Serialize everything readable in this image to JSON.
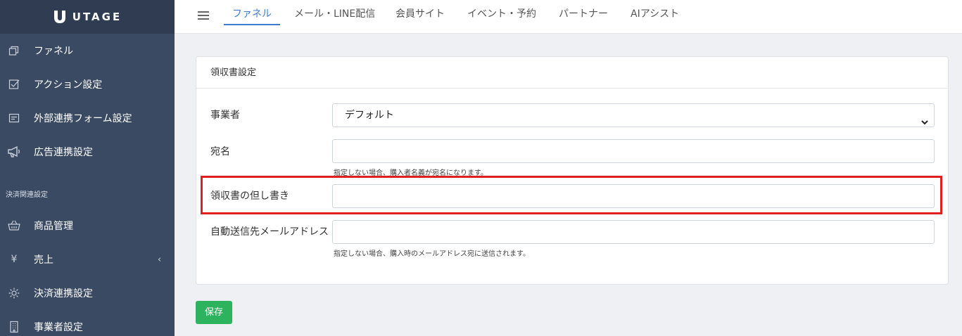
{
  "app": {
    "brand": "UTAGE"
  },
  "sidebar": {
    "items": [
      {
        "label": "ファネル",
        "icon": "funnel-pages-icon"
      },
      {
        "label": "アクション設定",
        "icon": "checkbox-icon"
      },
      {
        "label": "外部連携フォーム設定",
        "icon": "form-icon"
      },
      {
        "label": "広告連携設定",
        "icon": "megaphone-icon"
      }
    ],
    "section_label": "決済関連設定",
    "payment_items": [
      {
        "label": "商品管理",
        "icon": "basket-icon"
      },
      {
        "label": "売上",
        "icon": "yen-icon",
        "chevron": "‹"
      },
      {
        "label": "決済連携設定",
        "icon": "gear-icon"
      },
      {
        "label": "事業者設定",
        "icon": "building-icon"
      }
    ]
  },
  "topnav": {
    "tabs": [
      {
        "label": "ファネル",
        "active": true
      },
      {
        "label": "メール・LINE配信"
      },
      {
        "label": "会員サイト"
      },
      {
        "label": "イベント・予約"
      },
      {
        "label": "パートナー"
      },
      {
        "label": "AIアシスト"
      }
    ]
  },
  "card": {
    "title": "領収書設定",
    "fields": {
      "business": {
        "label": "事業者",
        "value": "デフォルト"
      },
      "recipient": {
        "label": "宛名",
        "value": "",
        "help": "指定しない場合、購入者名義が宛名になります。"
      },
      "proviso": {
        "label": "領収書の但し書き",
        "value": ""
      },
      "auto_email": {
        "label": "自動送信先メールアドレス",
        "value": "",
        "help": "指定しない場合、購入時のメールアドレス宛に送信されます。"
      }
    }
  },
  "actions": {
    "save_label": "保存"
  },
  "colors": {
    "sidebar": "#3b4a63",
    "accent": "#3f7bd0",
    "save": "#2db35d",
    "highlight": "#e02020"
  }
}
